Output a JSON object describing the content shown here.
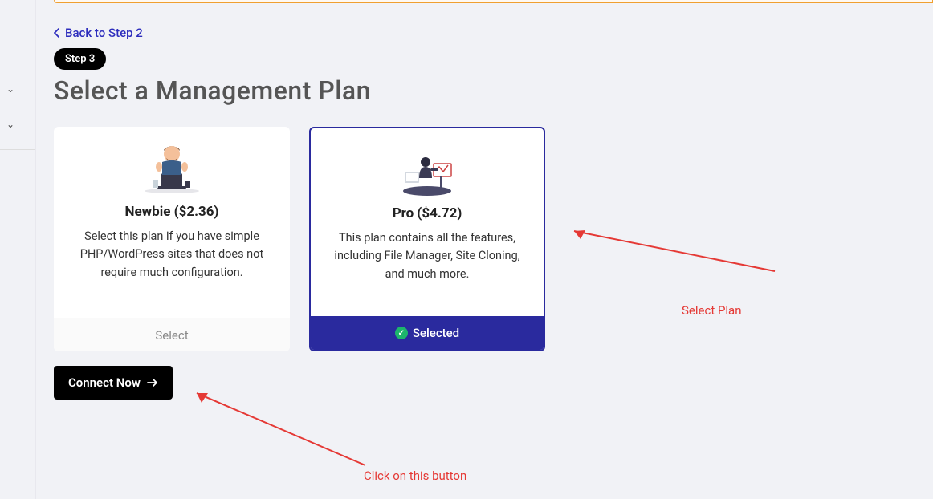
{
  "sidebar": {
    "chevron": "⌄"
  },
  "nav": {
    "back_label": "Back to Step 2",
    "step_badge": "Step 3"
  },
  "heading": "Select a Management Plan",
  "plans": [
    {
      "title": "Newbie ($2.36)",
      "desc": "Select this plan if you have simple PHP/WordPress sites that does not require much configuration.",
      "action": "Select",
      "selected": false
    },
    {
      "title": "Pro ($4.72)",
      "desc": "This plan contains all the features, including File Manager, Site Cloning, and much more.",
      "action": "Selected",
      "selected": true
    }
  ],
  "cta": {
    "label": "Connect Now"
  },
  "annotations": {
    "select_plan": "Select Plan",
    "click_button": "Click on this button"
  }
}
